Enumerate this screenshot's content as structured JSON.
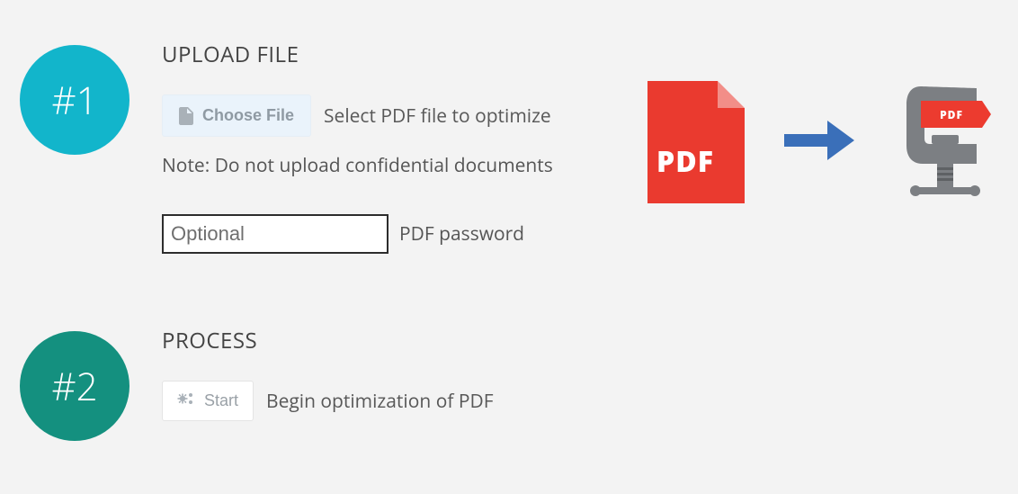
{
  "step1": {
    "badge": "#1",
    "title": "UPLOAD FILE",
    "choose_label": "Choose File",
    "choose_hint": "Select PDF file to optimize",
    "note": "Note: Do not upload confidential documents",
    "password_placeholder": "Optional",
    "password_label": "PDF password"
  },
  "step2": {
    "badge": "#2",
    "title": "PROCESS",
    "start_label": "Start",
    "start_hint": "Begin optimization of PDF"
  },
  "illustration": {
    "pdf_label": "PDF",
    "clamp_label": "PDF"
  }
}
